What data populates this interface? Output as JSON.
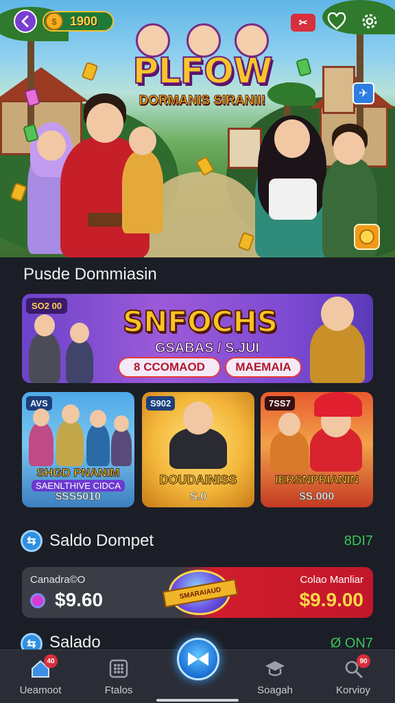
{
  "header": {
    "coins": "1900",
    "game_title": "PLFOW",
    "game_subtitle": "DORMANIS SIRANII!"
  },
  "section_title": "Pusde Dommiasin",
  "banner": {
    "tag": "SO2 00",
    "title": "SNFOCHS",
    "subtitle": "GSABAS / S.JUI",
    "pill_left": "8  CCOMAOD",
    "pill_right": "MAEMAIA"
  },
  "cards": [
    {
      "tag": "AVS",
      "name": "SHGD PNANIM",
      "desc": "SAENLTHIVE CIDCA",
      "price": "$SS5010"
    },
    {
      "tag": "S902",
      "name": "DOUDAINISS",
      "desc": "",
      "price": "S.0"
    },
    {
      "tag": "7SS7",
      "name": "IERSNPRIANIN",
      "desc": "",
      "price": "$S.000"
    }
  ],
  "balance": {
    "label": "Saldo Dompet",
    "value": "8DI7"
  },
  "wallet": {
    "left_label": "Canadra©O",
    "left_value": "$9.60",
    "right_label": "Colao Manliar",
    "right_value": "$9.9.00",
    "center_label": "SMARAIAUD"
  },
  "balance2": {
    "label": "Salado",
    "value": "Ø ON7"
  },
  "nav": {
    "items": [
      {
        "label": "Ueamoot",
        "icon": "home-icon",
        "badge": "40"
      },
      {
        "label": "Ftalos",
        "icon": "grid-icon"
      },
      {
        "label": "Soagah",
        "icon": "graduation-cap-icon"
      },
      {
        "label": "Korvioy",
        "icon": "search-icon",
        "badge": "90"
      }
    ]
  },
  "colors": {
    "accent": "#2f8fe0",
    "primary_red": "#d11d2c",
    "gold": "#f8c524",
    "background": "#1b1e26",
    "green_value": "#37c35a"
  }
}
